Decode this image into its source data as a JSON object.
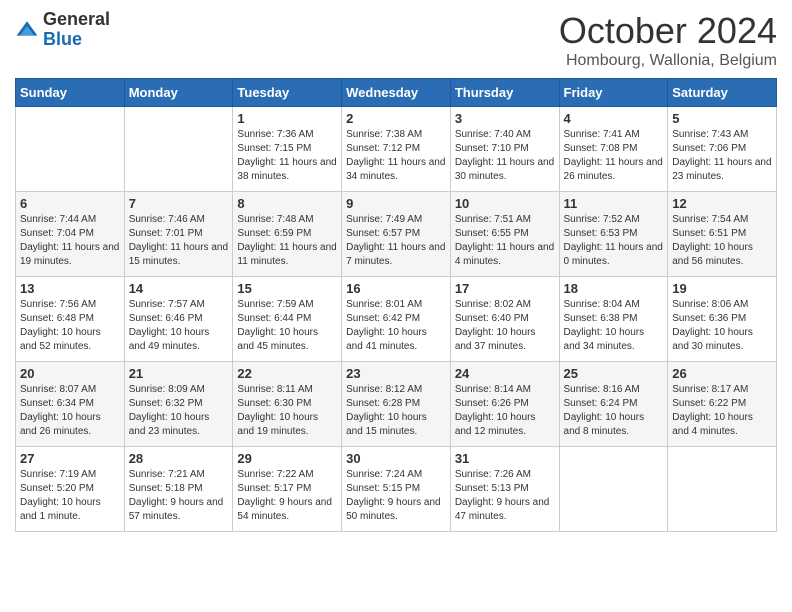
{
  "header": {
    "logo_general": "General",
    "logo_blue": "Blue",
    "month": "October 2024",
    "location": "Hombourg, Wallonia, Belgium"
  },
  "days_of_week": [
    "Sunday",
    "Monday",
    "Tuesday",
    "Wednesday",
    "Thursday",
    "Friday",
    "Saturday"
  ],
  "weeks": [
    [
      {
        "day": "",
        "info": ""
      },
      {
        "day": "",
        "info": ""
      },
      {
        "day": "1",
        "info": "Sunrise: 7:36 AM\nSunset: 7:15 PM\nDaylight: 11 hours and 38 minutes."
      },
      {
        "day": "2",
        "info": "Sunrise: 7:38 AM\nSunset: 7:12 PM\nDaylight: 11 hours and 34 minutes."
      },
      {
        "day": "3",
        "info": "Sunrise: 7:40 AM\nSunset: 7:10 PM\nDaylight: 11 hours and 30 minutes."
      },
      {
        "day": "4",
        "info": "Sunrise: 7:41 AM\nSunset: 7:08 PM\nDaylight: 11 hours and 26 minutes."
      },
      {
        "day": "5",
        "info": "Sunrise: 7:43 AM\nSunset: 7:06 PM\nDaylight: 11 hours and 23 minutes."
      }
    ],
    [
      {
        "day": "6",
        "info": "Sunrise: 7:44 AM\nSunset: 7:04 PM\nDaylight: 11 hours and 19 minutes."
      },
      {
        "day": "7",
        "info": "Sunrise: 7:46 AM\nSunset: 7:01 PM\nDaylight: 11 hours and 15 minutes."
      },
      {
        "day": "8",
        "info": "Sunrise: 7:48 AM\nSunset: 6:59 PM\nDaylight: 11 hours and 11 minutes."
      },
      {
        "day": "9",
        "info": "Sunrise: 7:49 AM\nSunset: 6:57 PM\nDaylight: 11 hours and 7 minutes."
      },
      {
        "day": "10",
        "info": "Sunrise: 7:51 AM\nSunset: 6:55 PM\nDaylight: 11 hours and 4 minutes."
      },
      {
        "day": "11",
        "info": "Sunrise: 7:52 AM\nSunset: 6:53 PM\nDaylight: 11 hours and 0 minutes."
      },
      {
        "day": "12",
        "info": "Sunrise: 7:54 AM\nSunset: 6:51 PM\nDaylight: 10 hours and 56 minutes."
      }
    ],
    [
      {
        "day": "13",
        "info": "Sunrise: 7:56 AM\nSunset: 6:48 PM\nDaylight: 10 hours and 52 minutes."
      },
      {
        "day": "14",
        "info": "Sunrise: 7:57 AM\nSunset: 6:46 PM\nDaylight: 10 hours and 49 minutes."
      },
      {
        "day": "15",
        "info": "Sunrise: 7:59 AM\nSunset: 6:44 PM\nDaylight: 10 hours and 45 minutes."
      },
      {
        "day": "16",
        "info": "Sunrise: 8:01 AM\nSunset: 6:42 PM\nDaylight: 10 hours and 41 minutes."
      },
      {
        "day": "17",
        "info": "Sunrise: 8:02 AM\nSunset: 6:40 PM\nDaylight: 10 hours and 37 minutes."
      },
      {
        "day": "18",
        "info": "Sunrise: 8:04 AM\nSunset: 6:38 PM\nDaylight: 10 hours and 34 minutes."
      },
      {
        "day": "19",
        "info": "Sunrise: 8:06 AM\nSunset: 6:36 PM\nDaylight: 10 hours and 30 minutes."
      }
    ],
    [
      {
        "day": "20",
        "info": "Sunrise: 8:07 AM\nSunset: 6:34 PM\nDaylight: 10 hours and 26 minutes."
      },
      {
        "day": "21",
        "info": "Sunrise: 8:09 AM\nSunset: 6:32 PM\nDaylight: 10 hours and 23 minutes."
      },
      {
        "day": "22",
        "info": "Sunrise: 8:11 AM\nSunset: 6:30 PM\nDaylight: 10 hours and 19 minutes."
      },
      {
        "day": "23",
        "info": "Sunrise: 8:12 AM\nSunset: 6:28 PM\nDaylight: 10 hours and 15 minutes."
      },
      {
        "day": "24",
        "info": "Sunrise: 8:14 AM\nSunset: 6:26 PM\nDaylight: 10 hours and 12 minutes."
      },
      {
        "day": "25",
        "info": "Sunrise: 8:16 AM\nSunset: 6:24 PM\nDaylight: 10 hours and 8 minutes."
      },
      {
        "day": "26",
        "info": "Sunrise: 8:17 AM\nSunset: 6:22 PM\nDaylight: 10 hours and 4 minutes."
      }
    ],
    [
      {
        "day": "27",
        "info": "Sunrise: 7:19 AM\nSunset: 5:20 PM\nDaylight: 10 hours and 1 minute."
      },
      {
        "day": "28",
        "info": "Sunrise: 7:21 AM\nSunset: 5:18 PM\nDaylight: 9 hours and 57 minutes."
      },
      {
        "day": "29",
        "info": "Sunrise: 7:22 AM\nSunset: 5:17 PM\nDaylight: 9 hours and 54 minutes."
      },
      {
        "day": "30",
        "info": "Sunrise: 7:24 AM\nSunset: 5:15 PM\nDaylight: 9 hours and 50 minutes."
      },
      {
        "day": "31",
        "info": "Sunrise: 7:26 AM\nSunset: 5:13 PM\nDaylight: 9 hours and 47 minutes."
      },
      {
        "day": "",
        "info": ""
      },
      {
        "day": "",
        "info": ""
      }
    ]
  ]
}
